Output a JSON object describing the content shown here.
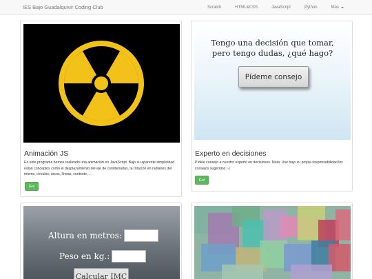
{
  "navbar": {
    "brand": "IES Bajo Guadalquivir Coding Club",
    "items": [
      "Scratch",
      "HTML&CSS",
      "JavaScript",
      "Python"
    ],
    "more": "Más"
  },
  "cards": [
    {
      "title": "Animación JS",
      "description": "En este programa hemos realizado una animación en JavaScript. Bajo su aparente simplicidad están conceptos como el desplazamiento del eje de coordenadas, la rotación en radianes del mismo, círculos, arcos, líneas, contexto, ...",
      "button": "Go!"
    },
    {
      "title": "Experto en decisiones",
      "description": "Pídele consejo a nuestro experto en decisiones. Nota: Use bajo su propia responsabilidad los consejos sugeridos :-)",
      "button": "Go!",
      "image_text_line1": "Tengo una decisión que tomar,",
      "image_text_line2": "pero tengo dudas, ¿qué hago?",
      "image_button": "Pídeme consejo"
    },
    {
      "image_label_height": "Altura en metros:",
      "image_label_weight": "Peso en kg.:",
      "image_button": "Calcular IMC"
    },
    {}
  ],
  "colors": {
    "radiation_yellow": "#f2c21b",
    "go_green": "#5cb85c"
  }
}
